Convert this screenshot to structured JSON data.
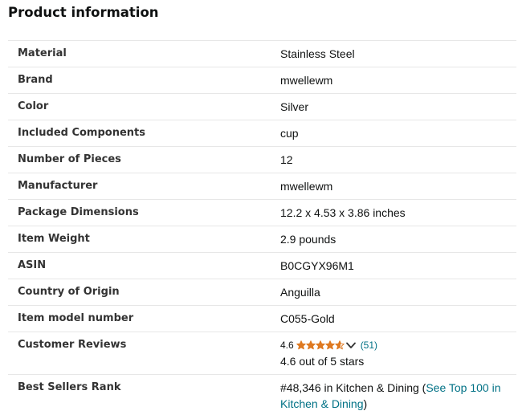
{
  "section": {
    "title": "Product information"
  },
  "rows": [
    {
      "key": "Material",
      "value": "Stainless Steel"
    },
    {
      "key": "Brand",
      "value": "mwellewm"
    },
    {
      "key": "Color",
      "value": "Silver"
    },
    {
      "key": "Included Components",
      "value": "cup"
    },
    {
      "key": "Number of Pieces",
      "value": "12"
    },
    {
      "key": "Manufacturer",
      "value": "mwellewm"
    },
    {
      "key": "Package Dimensions",
      "value": "12.2 x 4.53 x 3.86 inches"
    },
    {
      "key": "Item Weight",
      "value": "2.9 pounds"
    },
    {
      "key": "ASIN",
      "value": "B0CGYX96M1"
    },
    {
      "key": "Country of Origin",
      "value": "Anguilla"
    },
    {
      "key": "Item model number",
      "value": "C055-Gold"
    }
  ],
  "reviews": {
    "key": "Customer Reviews",
    "rating": "4.6",
    "stars_filled": 4.6,
    "stars_max": 5,
    "count": "(51)",
    "summary": "4.6 out of 5 stars",
    "star_color": "#DE7921"
  },
  "rank": {
    "key": "Best Sellers Rank",
    "text": "#48,346 in Kitchen & Dining (",
    "link": "See Top 100 in Kitchen & Dining",
    "close": ")"
  },
  "colors": {
    "link": "#007185",
    "divider": "#e7e7e7"
  }
}
